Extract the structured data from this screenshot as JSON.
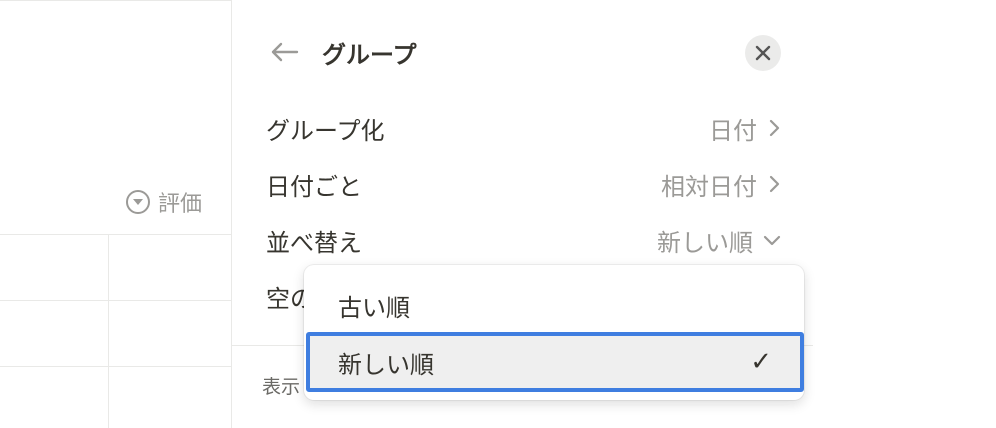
{
  "table": {
    "column_header": "評価",
    "column_icon": "dropdown-circle-icon"
  },
  "panel": {
    "title": "グループ",
    "back_icon": "arrow-left-icon",
    "close_icon": "close-icon",
    "rows": [
      {
        "label": "グループ化",
        "value": "日付",
        "chevron": "chevron-right-icon"
      },
      {
        "label": "日付ごと",
        "value": "相対日付",
        "chevron": "chevron-right-icon"
      },
      {
        "label": "並べ替え",
        "value": "新しい順",
        "chevron": "chevron-down-icon"
      },
      {
        "label": "空の"
      }
    ],
    "section_label": "表示"
  },
  "sort_menu": {
    "options": [
      {
        "label": "古い順",
        "selected": false
      },
      {
        "label": "新しい順",
        "selected": true
      }
    ],
    "check_glyph": "✓"
  },
  "colors": {
    "accent_focus": "#3f7ee0",
    "muted_text": "#9b9a97",
    "text": "#37352f"
  }
}
